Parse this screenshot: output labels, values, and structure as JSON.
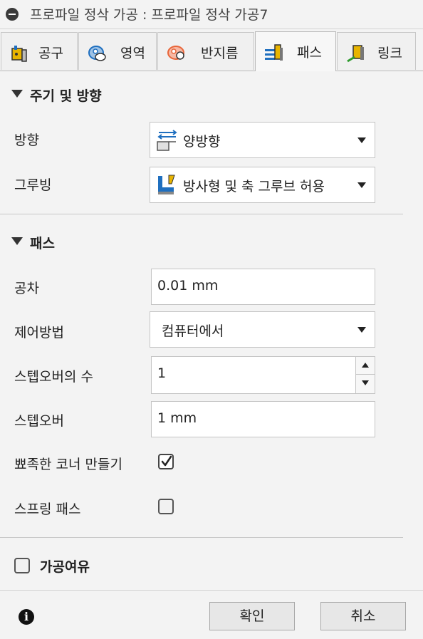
{
  "title": "프로파일 정삭 가공 : 프로파일 정삭 가공7",
  "tabs": [
    {
      "label": "공구",
      "icon": "tool-icon"
    },
    {
      "label": "영역",
      "icon": "area-icon"
    },
    {
      "label": "반지름",
      "icon": "radius-icon"
    },
    {
      "label": "패스",
      "icon": "passes-icon",
      "active": true
    },
    {
      "label": "링크",
      "icon": "linking-icon"
    }
  ],
  "section_cycle": {
    "title": "주기 및 방향",
    "direction_label": "방향",
    "direction_value": "양방향",
    "grooving_label": "그루빙",
    "grooving_value": "방사형 및 축 그루브 허용"
  },
  "section_passes": {
    "title": "패스",
    "tolerance_label": "공차",
    "tolerance_value": "0.01 mm",
    "compensation_label": "제어방법",
    "compensation_value": "컴퓨터에서",
    "stepovers_label": "스텝오버의 수",
    "stepovers_value": "1",
    "stepover_label": "스텝오버",
    "stepover_value": "1 mm",
    "sharp_corners_label": "뾰족한 코너 만들기",
    "sharp_corners_checked": true,
    "spring_pass_label": "스프링 패스",
    "spring_pass_checked": false
  },
  "stock_to_leave": {
    "label": "가공여유",
    "checked": false
  },
  "footer": {
    "ok_label": "확인",
    "cancel_label": "취소"
  },
  "colors": {
    "accent_blue": "#1f6fbf",
    "accent_yellow": "#e8b400",
    "accent_orange": "#e8663a"
  }
}
